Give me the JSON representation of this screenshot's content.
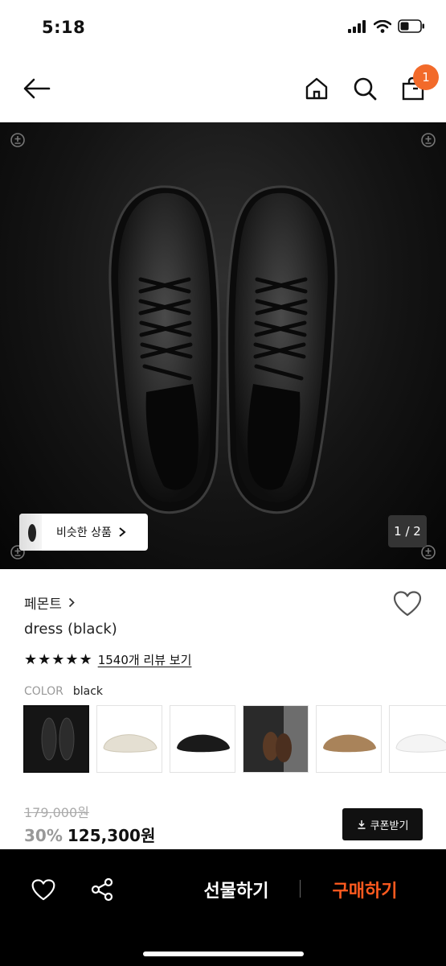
{
  "status_bar": {
    "time": "5:18"
  },
  "cart": {
    "count": "1"
  },
  "hero": {
    "similar_label": "비슷한 상품",
    "page_indicator": "1 / 2"
  },
  "product": {
    "brand": "페몬트",
    "name": "dress (black)",
    "stars": "★★★★★",
    "review_link": "1540개 리뷰 보기",
    "color_label": "COLOR",
    "color_value": "black"
  },
  "swatches": [
    {
      "name": "black (current)",
      "color": "#1a1a1a"
    },
    {
      "name": "cream",
      "color": "#e9e4d8"
    },
    {
      "name": "black suede",
      "color": "#1b1b1b"
    },
    {
      "name": "brown",
      "color": "#5b3a26"
    },
    {
      "name": "tan",
      "color": "#a9835a"
    },
    {
      "name": "white",
      "color": "#f3f3f3"
    }
  ],
  "price": {
    "original": "179,000원",
    "discount": "30%",
    "sale": "125,300원",
    "coupon_label": "쿠폰받기"
  },
  "bottom_bar": {
    "gift_label": "선물하기",
    "buy_label": "구매하기"
  },
  "colors": {
    "accent": "#ff5a1f",
    "badge": "#f26a2a"
  }
}
